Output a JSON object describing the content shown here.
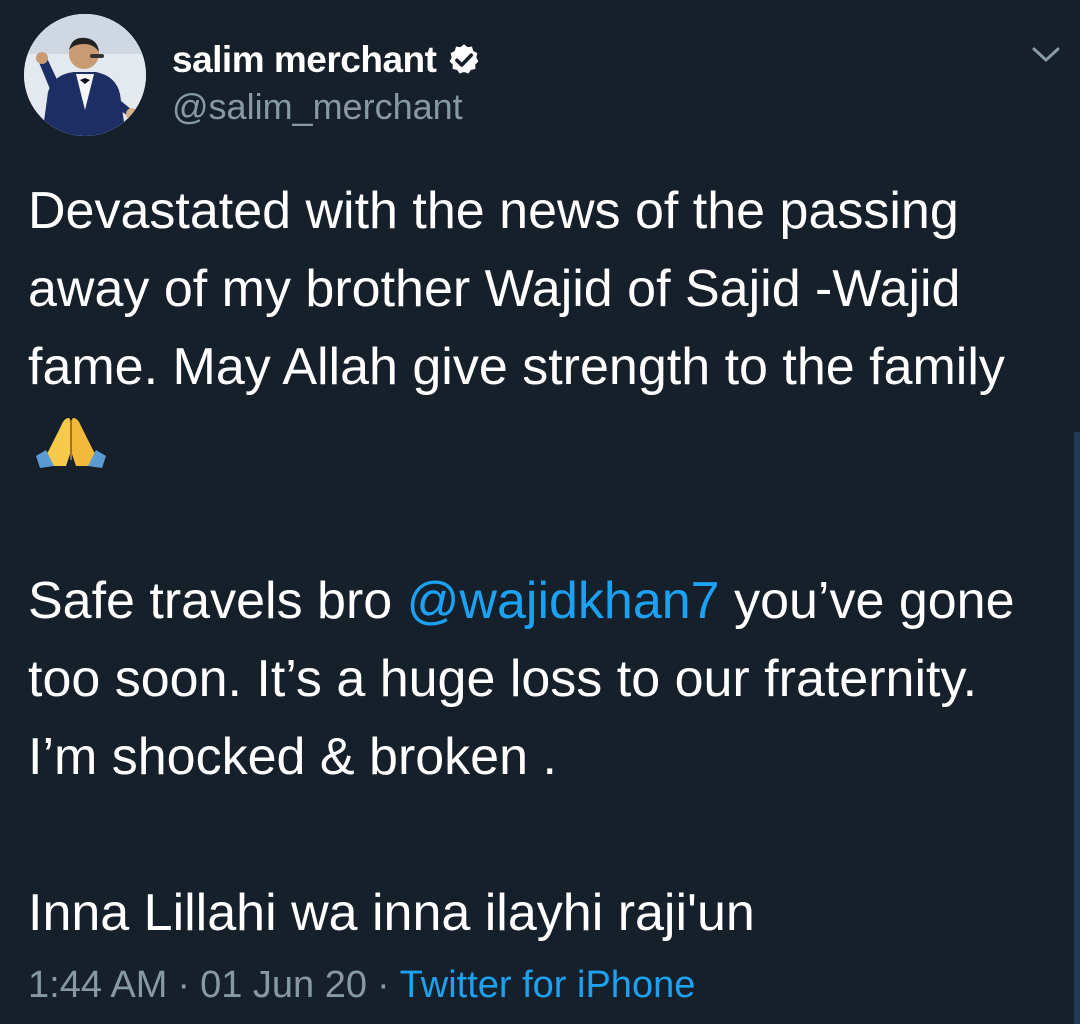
{
  "author": {
    "display_name": "salim merchant",
    "handle": "@salim_merchant",
    "verified": true,
    "avatar_icon": "singer-avatar"
  },
  "tweet": {
    "paragraph1": "Devastated with the news of the passing away of my brother Wajid of Sajid -Wajid fame. May Allah give strength to the family",
    "paragraph1_emoji": "folded-hands",
    "paragraph2_prefix": "Safe travels bro",
    "mention": "@wajidkhan7",
    "paragraph2_suffix": "you’ve gone too soon. It’s a huge loss to our fraternity. I’m shocked & broken .",
    "paragraph3": "Inna Lillahi wa inna ilayhi raji'un"
  },
  "meta": {
    "time": "1:44 AM",
    "date": "01 Jun 20",
    "separator": "·",
    "source": "Twitter for iPhone"
  },
  "colors": {
    "background": "#15202b",
    "primary_text": "#ffffff",
    "secondary_text": "#8899a6",
    "link": "#1da1f2"
  },
  "icons": {
    "verified": "verified-badge-icon",
    "menu": "chevron-down-icon",
    "emoji": "folded-hands-icon"
  }
}
